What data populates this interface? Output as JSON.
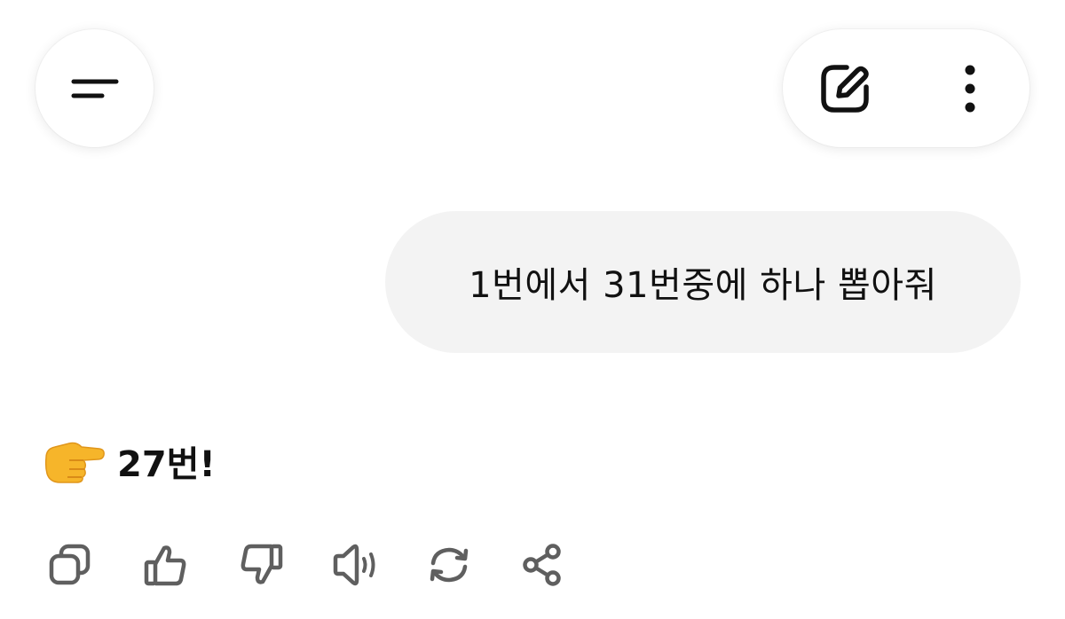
{
  "header": {
    "menu_icon": "hamburger-menu-icon",
    "edit_icon": "edit-pencil-icon",
    "more_icon": "more-vertical-icon"
  },
  "conversation": {
    "user_message": "1번에서 31번중에 하나 뽑아줘",
    "assistant_emoji": "👉",
    "assistant_message": "27번!"
  },
  "actions": [
    {
      "icon": "copy-icon"
    },
    {
      "icon": "thumbs-up-icon"
    },
    {
      "icon": "thumbs-down-icon"
    },
    {
      "icon": "read-aloud-icon"
    },
    {
      "icon": "regenerate-icon"
    },
    {
      "icon": "share-icon"
    }
  ],
  "colors": {
    "bubble": "#f3f3f3",
    "icon_dark": "#111111",
    "icon_muted": "#5f5f5f",
    "emoji_hand": "#f6b52a"
  }
}
